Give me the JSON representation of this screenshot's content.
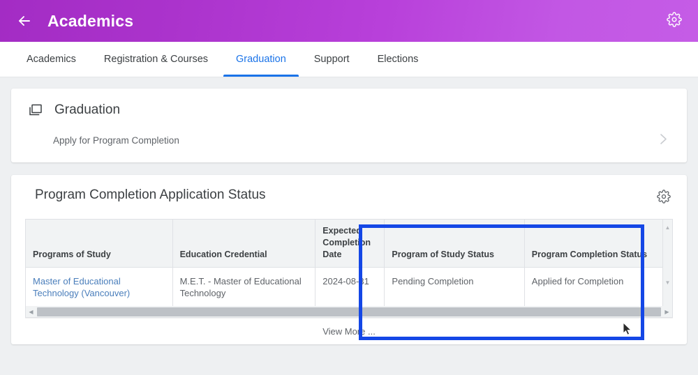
{
  "appbar": {
    "title": "Academics",
    "back_icon": "arrow-left-icon",
    "gear_icon": "gear-icon"
  },
  "tabs": [
    {
      "label": "Academics",
      "active": false
    },
    {
      "label": "Registration & Courses",
      "active": false
    },
    {
      "label": "Graduation",
      "active": true
    },
    {
      "label": "Support",
      "active": false
    },
    {
      "label": "Elections",
      "active": false
    }
  ],
  "graduation_card": {
    "icon": "window-duplicate-icon",
    "title": "Graduation",
    "link_label": "Apply for Program Completion",
    "chevron": "chevron-right-icon"
  },
  "status_card": {
    "title": "Program Completion Application Status",
    "gear_icon": "gear-icon",
    "view_more_label": "View More ...",
    "table": {
      "columns": [
        "Programs of Study",
        "Education Credential",
        "Expected Completion Date",
        "Program of Study Status",
        "Program Completion Status"
      ],
      "rows": [
        {
          "program_of_study": "Master of Educational Technology (Vancouver)",
          "education_credential": "M.E.T. - Master of Educational Technology",
          "expected_completion_date": "2024-08-31",
          "program_of_study_status": "Pending Completion",
          "program_completion_status": "Applied for Completion"
        }
      ]
    },
    "scrollbars": {
      "v_up": "scroll-up-arrow-icon",
      "v_down": "scroll-down-arrow-icon",
      "h_left": "scroll-left-arrow-icon",
      "h_right": "scroll-right-arrow-icon"
    }
  },
  "annotation": {
    "highlight_color": "#1447e6"
  },
  "colors": {
    "appbar_gradient_start": "#a32cc4",
    "appbar_gradient_end": "#c55ce6",
    "tab_active": "#1a73e8",
    "link": "#4a7ebb",
    "page_background": "#eef0f2"
  }
}
